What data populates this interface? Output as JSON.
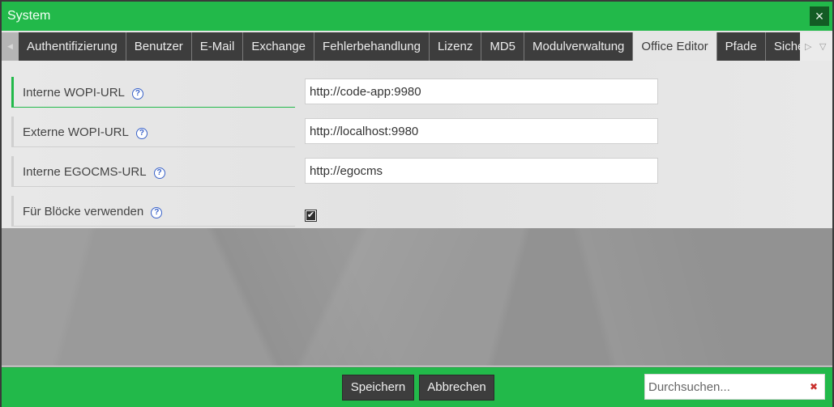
{
  "window": {
    "title": "System",
    "close_icon": "×"
  },
  "tabs": {
    "scroll_left_icon": "◀",
    "scroll_right_icon": "▷",
    "menu_icon": "▽",
    "items": [
      {
        "label": "Authentifizierung",
        "active": false
      },
      {
        "label": "Benutzer",
        "active": false
      },
      {
        "label": "E-Mail",
        "active": false
      },
      {
        "label": "Exchange",
        "active": false
      },
      {
        "label": "Fehlerbehandlung",
        "active": false
      },
      {
        "label": "Lizenz",
        "active": false
      },
      {
        "label": "MD5",
        "active": false
      },
      {
        "label": "Modulverwaltung",
        "active": false
      },
      {
        "label": "Office Editor",
        "active": true
      },
      {
        "label": "Pfade",
        "active": false
      },
      {
        "label": "Sicherh",
        "active": false
      }
    ]
  },
  "form": {
    "help_icon": "?",
    "fields": [
      {
        "label": "Interne WOPI-URL",
        "type": "text",
        "value": "http://code-app:9980",
        "focused": true
      },
      {
        "label": "Externe WOPI-URL",
        "type": "text",
        "value": "http://localhost:9980",
        "focused": false
      },
      {
        "label": "Interne EGOCMS-URL",
        "type": "text",
        "value": "http://egocms",
        "focused": false
      },
      {
        "label": "Für Blöcke verwenden",
        "type": "checkbox",
        "checked": true,
        "check_glyph": "✔",
        "focused": false
      }
    ]
  },
  "footer": {
    "save_label": "Speichern",
    "cancel_label": "Abbrechen",
    "search_placeholder": "Durchsuchen...",
    "search_value": "",
    "clear_icon": "✖"
  },
  "colors": {
    "accent": "#22b94a",
    "tab_dark": "#3d3d3d",
    "close_bg": "#135c24",
    "help_blue": "#3a63c9",
    "clear_red": "#c9302c"
  }
}
